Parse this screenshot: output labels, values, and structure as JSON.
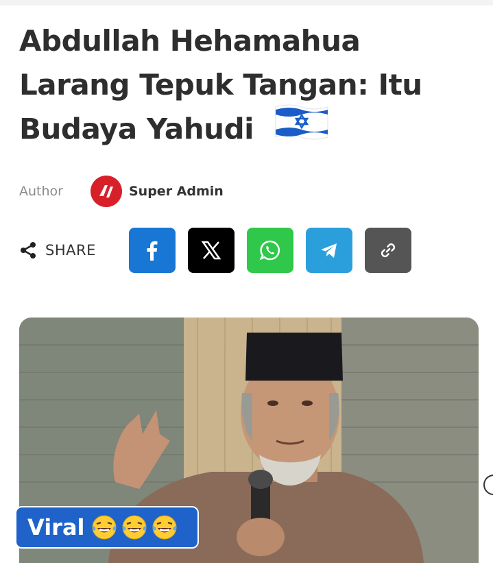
{
  "article": {
    "title": "Abdullah Hehamahua Larang Tepuk Tangan: Itu Budaya Yahudi",
    "flag_icon": "israel-flag-icon"
  },
  "author": {
    "label": "Author",
    "name": "Super Admin",
    "avatar_color": "#d8202a"
  },
  "share": {
    "label": "SHARE",
    "buttons": [
      {
        "icon": "facebook-icon",
        "color": "#1877d4"
      },
      {
        "icon": "x-icon",
        "color": "#000000"
      },
      {
        "icon": "whatsapp-icon",
        "color": "#2fc84a"
      },
      {
        "icon": "telegram-icon",
        "color": "#2a9fdc"
      },
      {
        "icon": "link-icon",
        "color": "#555555"
      }
    ]
  },
  "media": {
    "badge_text": "Viral",
    "badge_icons": [
      "laughing-crying-emoji-icon",
      "laughing-crying-emoji-icon",
      "laughing-crying-emoji-icon"
    ],
    "badge_color": "#1f62c9"
  }
}
